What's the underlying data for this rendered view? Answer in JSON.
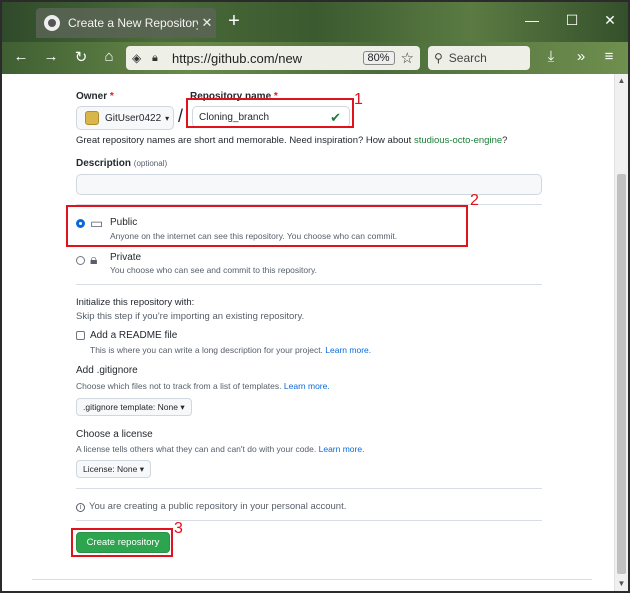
{
  "browser": {
    "tab_title": "Create a New Repository",
    "tab_close": "✕",
    "new_tab": "+",
    "url": "https://github.com/new",
    "zoom": "80%",
    "search_placeholder": "Search",
    "window_controls": [
      "—",
      "☐",
      "✕"
    ]
  },
  "form": {
    "owner_label": "Owner",
    "owner_required": "*",
    "owner_value": "GitUser0422",
    "owner_caret": "▾",
    "slash": "/",
    "repo_label": "Repository name",
    "repo_required": "*",
    "repo_value": "Cloning_branch",
    "check": "✔",
    "name_hint_prefix": "Great repository names are short and memorable. Need inspiration? How about",
    "name_suggestion": "studious-octo-engine",
    "name_hint_suffix": "?",
    "description_label": "Description",
    "description_optional": "(optional)",
    "public_label": "Public",
    "public_desc": "Anyone on the internet can see this repository. You choose who can commit.",
    "private_label": "Private",
    "private_desc": "You choose who can see and commit to this repository.",
    "init_heading": "Initialize this repository with:",
    "init_sub": "Skip this step if you're importing an existing repository.",
    "readme_label": "Add a README file",
    "readme_desc": "This is where you can write a long description for your project.",
    "learn_more": "Learn more.",
    "gitignore_label": "Add .gitignore",
    "gitignore_desc": "Choose which files not to track from a list of templates.",
    "gitignore_select": ".gitignore template: None ▾",
    "license_label": "Choose a license",
    "license_desc": "A license tells others what they can and can't do with your code.",
    "license_select": "License: None ▾",
    "notice": "You are creating a public repository in your personal account.",
    "create_button": "Create repository"
  },
  "annotations": {
    "one": "1",
    "two": "2",
    "three": "3",
    "color": "#e0121b"
  },
  "colors": {
    "create_button": "#2da44e",
    "link": "#0969da",
    "suggestion": "#1a7f37"
  }
}
